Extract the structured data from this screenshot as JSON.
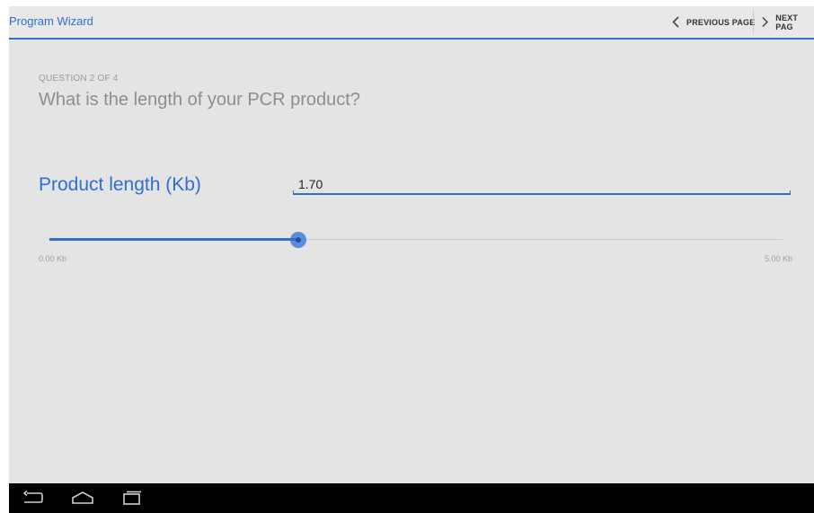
{
  "actionbar": {
    "back_label": "Program Wizard",
    "prev_label": "PREVIOUS PAGE",
    "next_label": "NEXT PAG",
    "accent": "#2f6fce"
  },
  "question": {
    "number_text": "QUESTION 2 OF 4",
    "title": "What is the length of your PCR product?"
  },
  "field": {
    "label": "Product length (Kb)",
    "value": "1.70"
  },
  "slider": {
    "min_label": "0.00 Kb",
    "max_label": "5.00 Kb",
    "min": 0,
    "max": 5,
    "value": 1.7
  },
  "system_nav": {
    "icons": [
      "back-icon",
      "home-icon",
      "recent-apps-icon"
    ]
  }
}
